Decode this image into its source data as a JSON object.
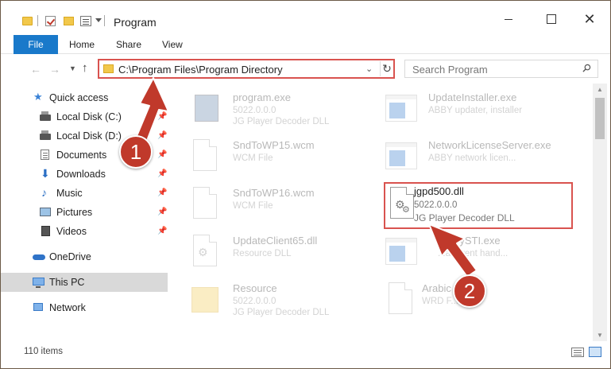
{
  "window": {
    "title": "Program",
    "controls": {
      "minimize": "minimize",
      "maximize": "maximize",
      "close": "✕"
    }
  },
  "ribbon": {
    "tabs": [
      {
        "label": "File",
        "active": true
      },
      {
        "label": "Home"
      },
      {
        "label": "Share"
      },
      {
        "label": "View"
      }
    ]
  },
  "address": {
    "path": "C:\\Program Files\\Program Directory",
    "search_placeholder": "Search Program"
  },
  "sidebar": {
    "items": [
      {
        "label": "Quick access",
        "icon": "star-icon"
      },
      {
        "label": "Local Disk (C:)",
        "icon": "drive-icon",
        "pinned": true
      },
      {
        "label": "Local Disk (D:)",
        "icon": "drive-icon",
        "pinned": true
      },
      {
        "label": "Documents",
        "icon": "documents-icon",
        "pinned": true
      },
      {
        "label": "Downloads",
        "icon": "downloads-icon",
        "pinned": true
      },
      {
        "label": "Music",
        "icon": "music-icon",
        "pinned": true
      },
      {
        "label": "Pictures",
        "icon": "pictures-icon",
        "pinned": true
      },
      {
        "label": "Videos",
        "icon": "videos-icon",
        "pinned": true
      },
      {
        "label": "OneDrive",
        "icon": "cloud-icon"
      },
      {
        "label": "This PC",
        "icon": "computer-icon",
        "selected": true
      },
      {
        "label": "Network",
        "icon": "network-icon"
      }
    ]
  },
  "files": [
    {
      "name": "program.exe",
      "line2": "5022.0.0.0",
      "line3": "JG Player Decoder DLL",
      "icon": "program-icon"
    },
    {
      "name": "UpdateInstaller.exe",
      "line2": "ABBY updater, installer",
      "line3": "",
      "icon": "app-window-icon"
    },
    {
      "name": "SndToWP15.wcm",
      "line2": "WCM File",
      "line3": "",
      "icon": "document-icon"
    },
    {
      "name": "NetworkLicenseServer.exe",
      "line2": "ABBY network licen...",
      "line3": "",
      "icon": "app-window-icon"
    },
    {
      "name": "SndToWP16.wcm",
      "line2": "WCM File",
      "line3": "",
      "icon": "document-icon"
    },
    {
      "name": "jgpd500.dll",
      "line2": "5022.0.0.0",
      "line3": "JG Player Decoder DLL",
      "icon": "dll-gear-icon",
      "highlighted": true
    },
    {
      "name": "UpdateClient65.dll",
      "line2": "Resource DLL",
      "line3": "",
      "icon": "dll-gear-icon"
    },
    {
      "name": "...yySTI.exe",
      "line2": "...ai event hand...",
      "line3": "",
      "icon": "app-window-icon"
    },
    {
      "name": "Resource",
      "line2": "5022.0.0.0",
      "line3": "JG Player Decoder DLL",
      "icon": "folder-icon"
    },
    {
      "name": "Arabic",
      "line2": "WRD F...",
      "line3": "",
      "icon": "document-icon"
    }
  ],
  "status": {
    "item_count": "110 items"
  },
  "callouts": [
    "1",
    "2"
  ],
  "colors": {
    "accent": "#1979ca",
    "highlight_border": "#d9534f",
    "callout": "#c0392b"
  }
}
